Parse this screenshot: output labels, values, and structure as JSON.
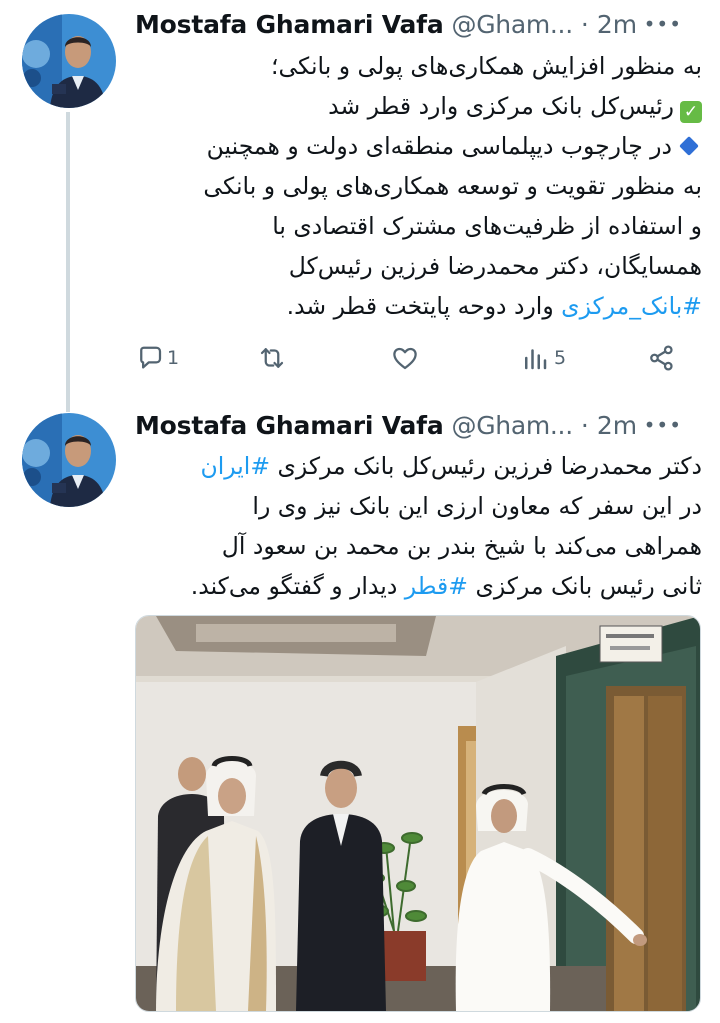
{
  "tweets": [
    {
      "author_name": "Mostafa Ghamari Vafa",
      "handle": "@Gham...",
      "separator": "·",
      "time": "2m",
      "lines": [
        "به منظور افزایش همکاری‌های پولی و بانکی؛",
        "رئیس‌کل بانک مرکزی وارد قطر شد",
        "در چارچوب دیپلماسی منطقه‌ای دولت و همچنین",
        "به منظور تقویت و توسعه همکاری‌های پولی و بانکی",
        "و استفاده از ظرفیت‌های مشترک اقتصادی با",
        "همسایگان، دکتر محمدرضا فرزین رئیس‌کل"
      ],
      "last_line": {
        "hashtag": "#بانک_مرکزی",
        "text": "وارد دوحه پایتخت قطر شد."
      },
      "actions": {
        "reply_count": "1",
        "retweet_count": "",
        "like_count": "",
        "views_count": "5"
      }
    },
    {
      "author_name": "Mostafa Ghamari Vafa",
      "handle": "@Gham...",
      "separator": "·",
      "time": "2m",
      "first_line": {
        "text": "دکتر محمدرضا فرزین رئیس‌کل بانک مرکزی",
        "hashtag": "#ایران"
      },
      "lines": [
        "در این سفر که معاون ارزی این بانک نیز وی را",
        "همراهی می‌کند با شیخ بندر بن محمد بن سعود آل"
      ],
      "last_line": {
        "text_before": "ثانی رئیس بانک مرکزی",
        "hashtag": "#قطر",
        "text_after": "دیدار و گفتگو می‌کند."
      }
    }
  ],
  "icons": {
    "more": "more-icon",
    "reply": "reply-icon",
    "retweet": "retweet-icon",
    "like": "like-icon",
    "views": "views-icon",
    "share": "share-icon",
    "check": "check-mark-emoji",
    "diamond": "blue-diamond-emoji"
  },
  "colors": {
    "hashtag": "#1d9bf0",
    "secondary_text": "#536471",
    "thread_line": "#cfd9de"
  }
}
